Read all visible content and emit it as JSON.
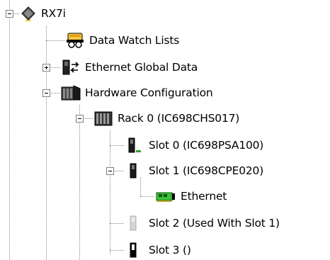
{
  "tree": {
    "root": {
      "label": "RX7i",
      "icon": "rx7i-chip-icon",
      "expanded": true
    },
    "items": [
      {
        "label": "Data Watch Lists",
        "icon": "data-watch-icon"
      },
      {
        "label": "Ethernet Global Data",
        "icon": "ethernet-global-data-icon",
        "expanded": false
      },
      {
        "label": "Hardware Configuration",
        "icon": "hardware-config-icon",
        "expanded": true
      },
      {
        "label": "Rack 0 (IC698CHS017)",
        "icon": "rack-icon",
        "expanded": true
      },
      {
        "label": "Slot 0 (IC698PSA100)",
        "icon": "power-supply-module-icon"
      },
      {
        "label": "Slot 1 (IC698CPE020)",
        "icon": "cpu-module-icon",
        "expanded": true
      },
      {
        "label": "Ethernet",
        "icon": "ethernet-card-icon"
      },
      {
        "label": "Slot 2 (Used With Slot 1)",
        "icon": "empty-slot-icon"
      },
      {
        "label": "Slot 3 ()",
        "icon": "slot-module-icon"
      }
    ]
  }
}
